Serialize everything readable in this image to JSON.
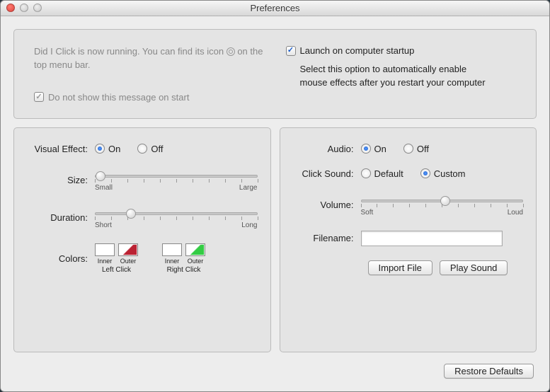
{
  "window": {
    "title": "Preferences"
  },
  "top": {
    "running_msg_a": "Did I Click is now running. You can find its icon ",
    "running_msg_b": " on the top menu bar.",
    "dont_show_label": "Do not show this message on start",
    "launch_label": "Launch on computer startup",
    "launch_desc": "Select this option to automatically enable mouse effects after you restart your computer"
  },
  "visual": {
    "effect_label": "Visual Effect:",
    "on": "On",
    "off": "Off",
    "size_label": "Size:",
    "size_min": "Small",
    "size_max": "Large",
    "duration_label": "Duration:",
    "duration_min": "Short",
    "duration_max": "Long",
    "colors_label": "Colors:",
    "inner": "Inner",
    "outer": "Outer",
    "left_click": "Left Click",
    "right_click": "Right Click"
  },
  "audio": {
    "audio_label": "Audio:",
    "on": "On",
    "off": "Off",
    "click_sound_label": "Click Sound:",
    "default": "Default",
    "custom": "Custom",
    "volume_label": "Volume:",
    "volume_min": "Soft",
    "volume_max": "Loud",
    "filename_label": "Filename:",
    "filename_value": "",
    "import_btn": "Import File",
    "play_btn": "Play Sound"
  },
  "footer": {
    "restore_btn": "Restore Defaults"
  }
}
